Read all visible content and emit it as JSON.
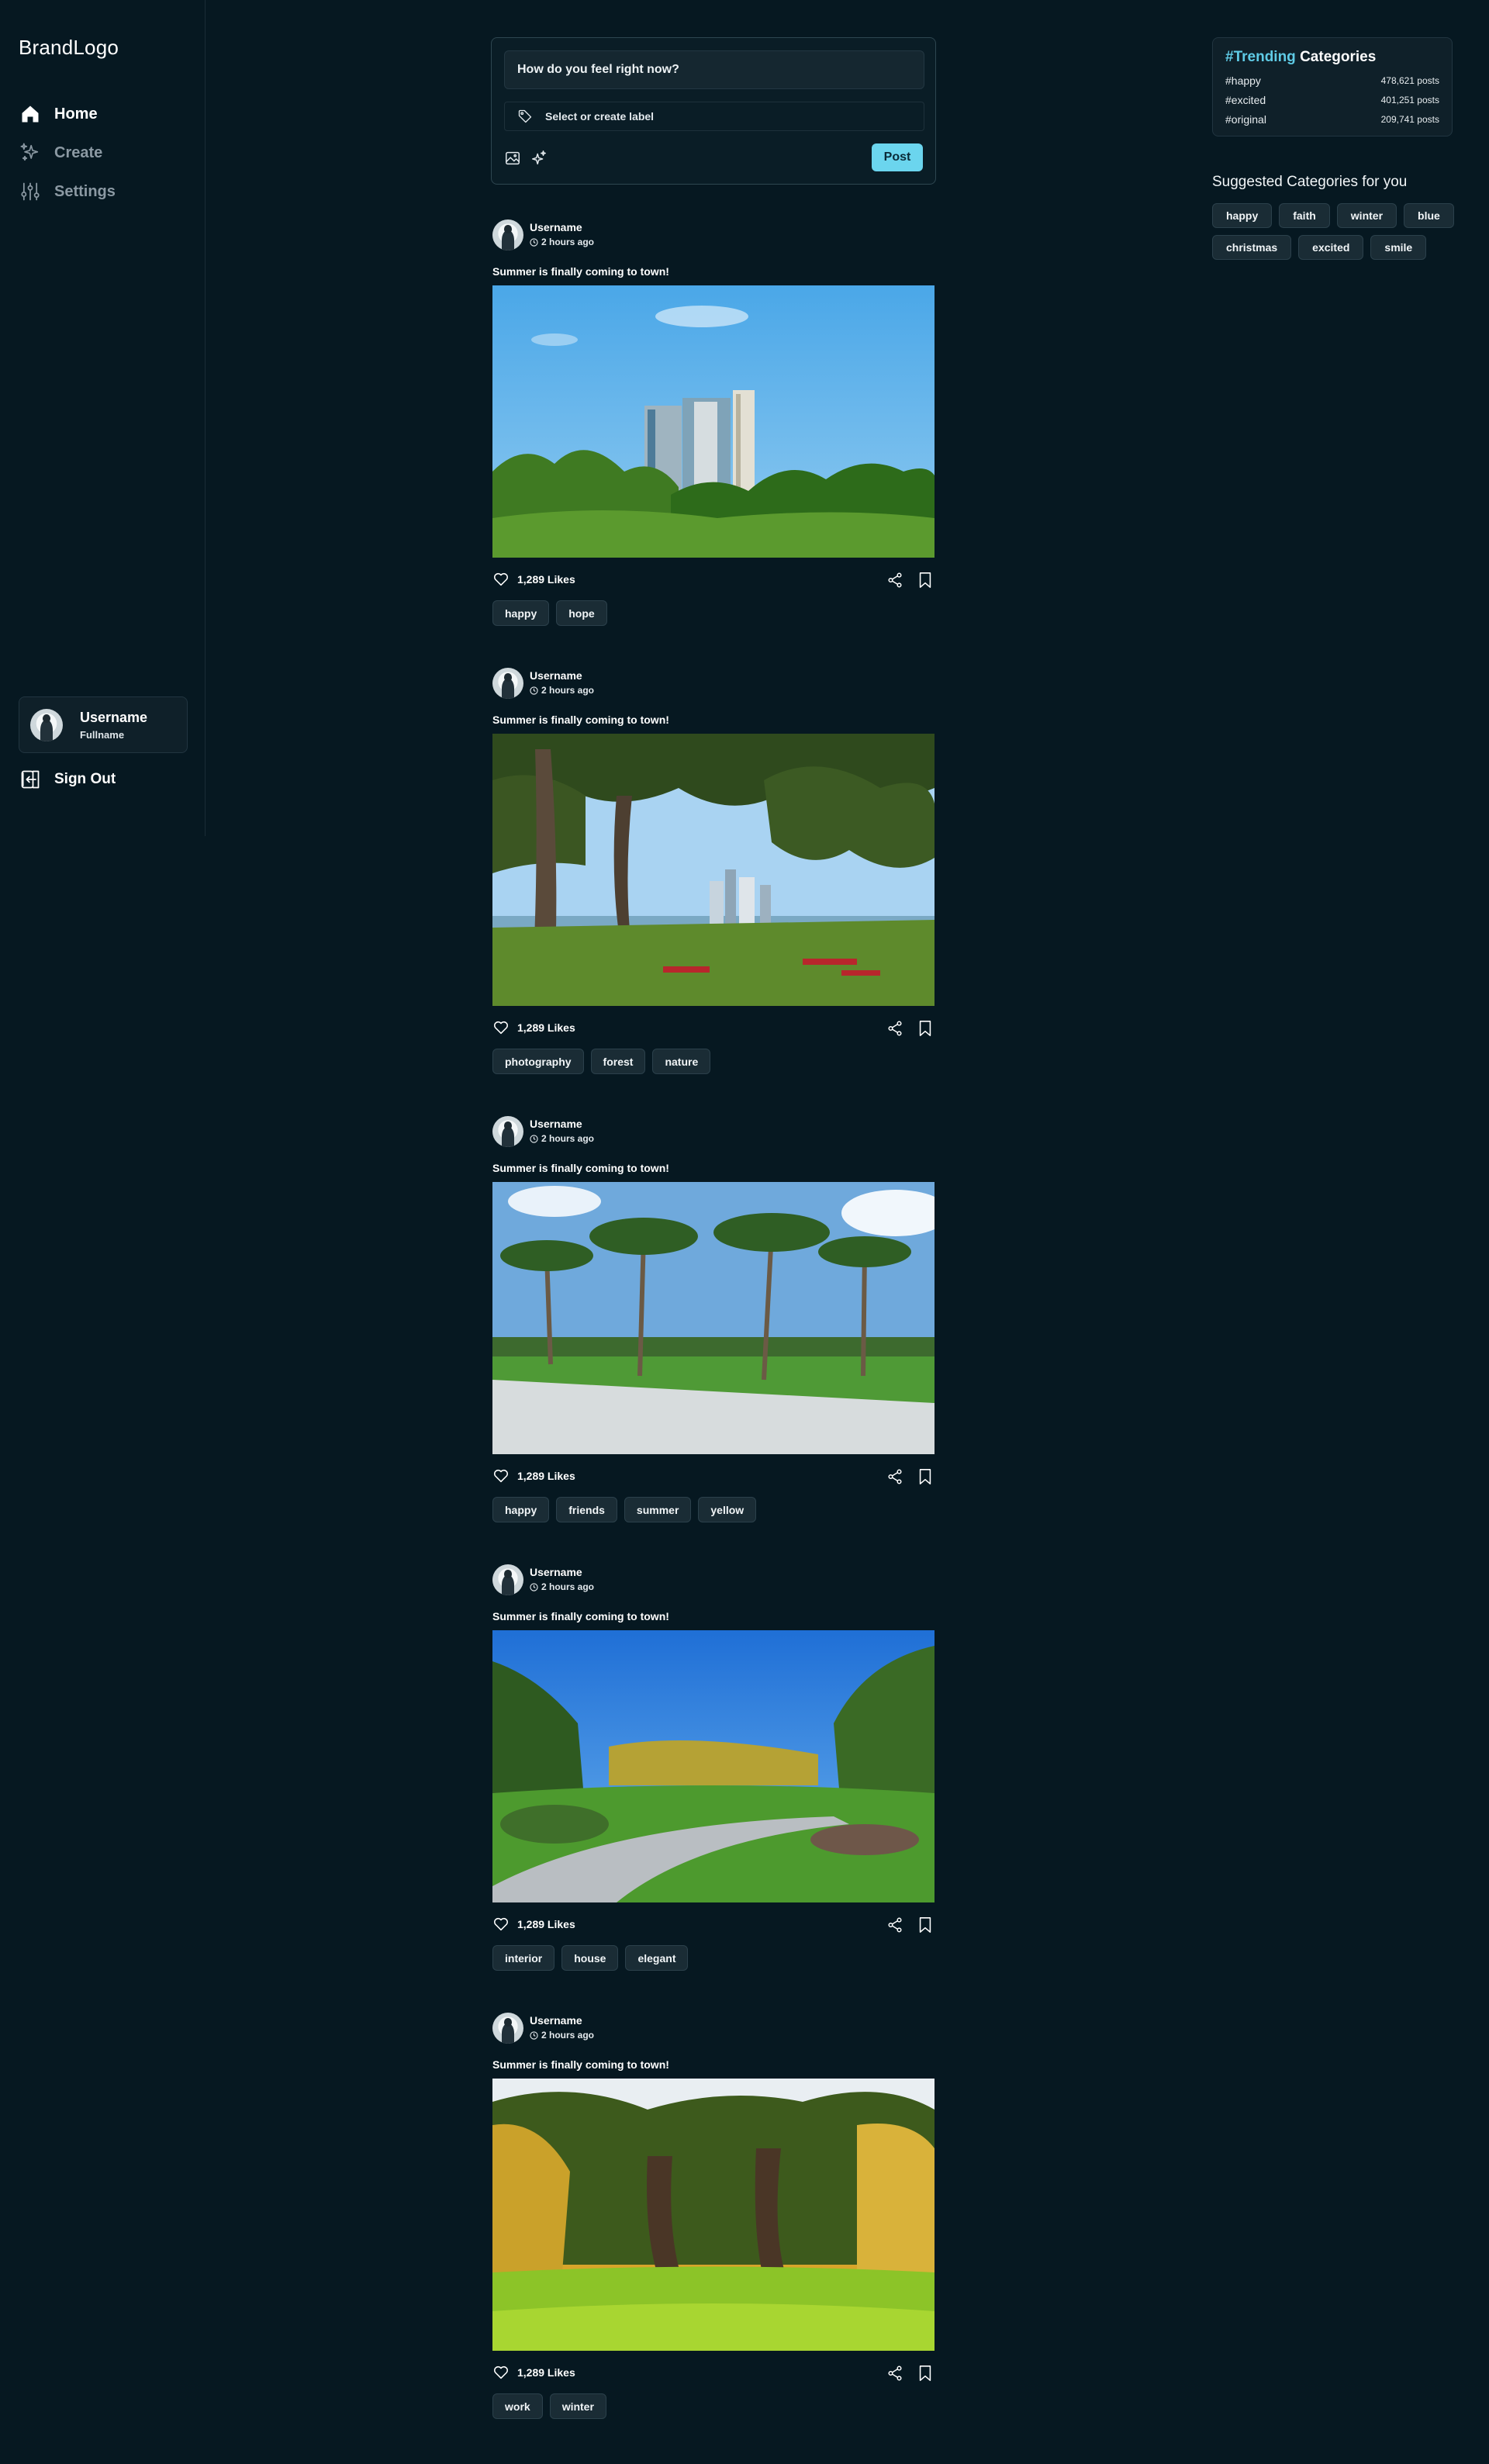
{
  "brand": "BrandLogo",
  "nav": {
    "home": "Home",
    "create": "Create",
    "settings": "Settings"
  },
  "user": {
    "username": "Username",
    "fullname": "Fullname"
  },
  "signout": "Sign Out",
  "composer": {
    "prompt": "How do you feel right now?",
    "label_placeholder": "Select or create label",
    "post_button": "Post"
  },
  "posts": [
    {
      "username": "Username",
      "time": "2 hours ago",
      "caption": "Summer is finally coming to town!",
      "likes": "1,289 Likes",
      "image": "city-towers",
      "tags": [
        "happy",
        "hope"
      ]
    },
    {
      "username": "Username",
      "time": "2 hours ago",
      "caption": "Summer is finally coming to town!",
      "likes": "1,289 Likes",
      "image": "park-picnic",
      "tags": [
        "photography",
        "forest",
        "nature"
      ]
    },
    {
      "username": "Username",
      "time": "2 hours ago",
      "caption": "Summer is finally coming to town!",
      "likes": "1,289 Likes",
      "image": "palm-trees",
      "tags": [
        "happy",
        "friends",
        "summer",
        "yellow"
      ]
    },
    {
      "username": "Username",
      "time": "2 hours ago",
      "caption": "Summer is finally coming to town!",
      "likes": "1,289 Likes",
      "image": "garden-path",
      "tags": [
        "interior",
        "house",
        "elegant"
      ]
    },
    {
      "username": "Username",
      "time": "2 hours ago",
      "caption": "Summer is finally coming to town!",
      "likes": "1,289 Likes",
      "image": "autumn-park",
      "tags": [
        "work",
        "winter"
      ]
    }
  ],
  "trending": {
    "title_accent": "#Trending",
    "title_rest": "Categories",
    "items": [
      {
        "name": "#happy",
        "count": "478,621 posts"
      },
      {
        "name": "#excited",
        "count": "401,251 posts"
      },
      {
        "name": "#original",
        "count": "209,741 posts"
      }
    ]
  },
  "suggested": {
    "title": "Suggested Categories for you",
    "tags": [
      "happy",
      "faith",
      "winter",
      "blue",
      "christmas",
      "excited",
      "smile"
    ]
  },
  "colors": {
    "background": "#061821",
    "accent": "#6bd5ee",
    "card": "#0f2029",
    "tag": "#1a2c35"
  }
}
